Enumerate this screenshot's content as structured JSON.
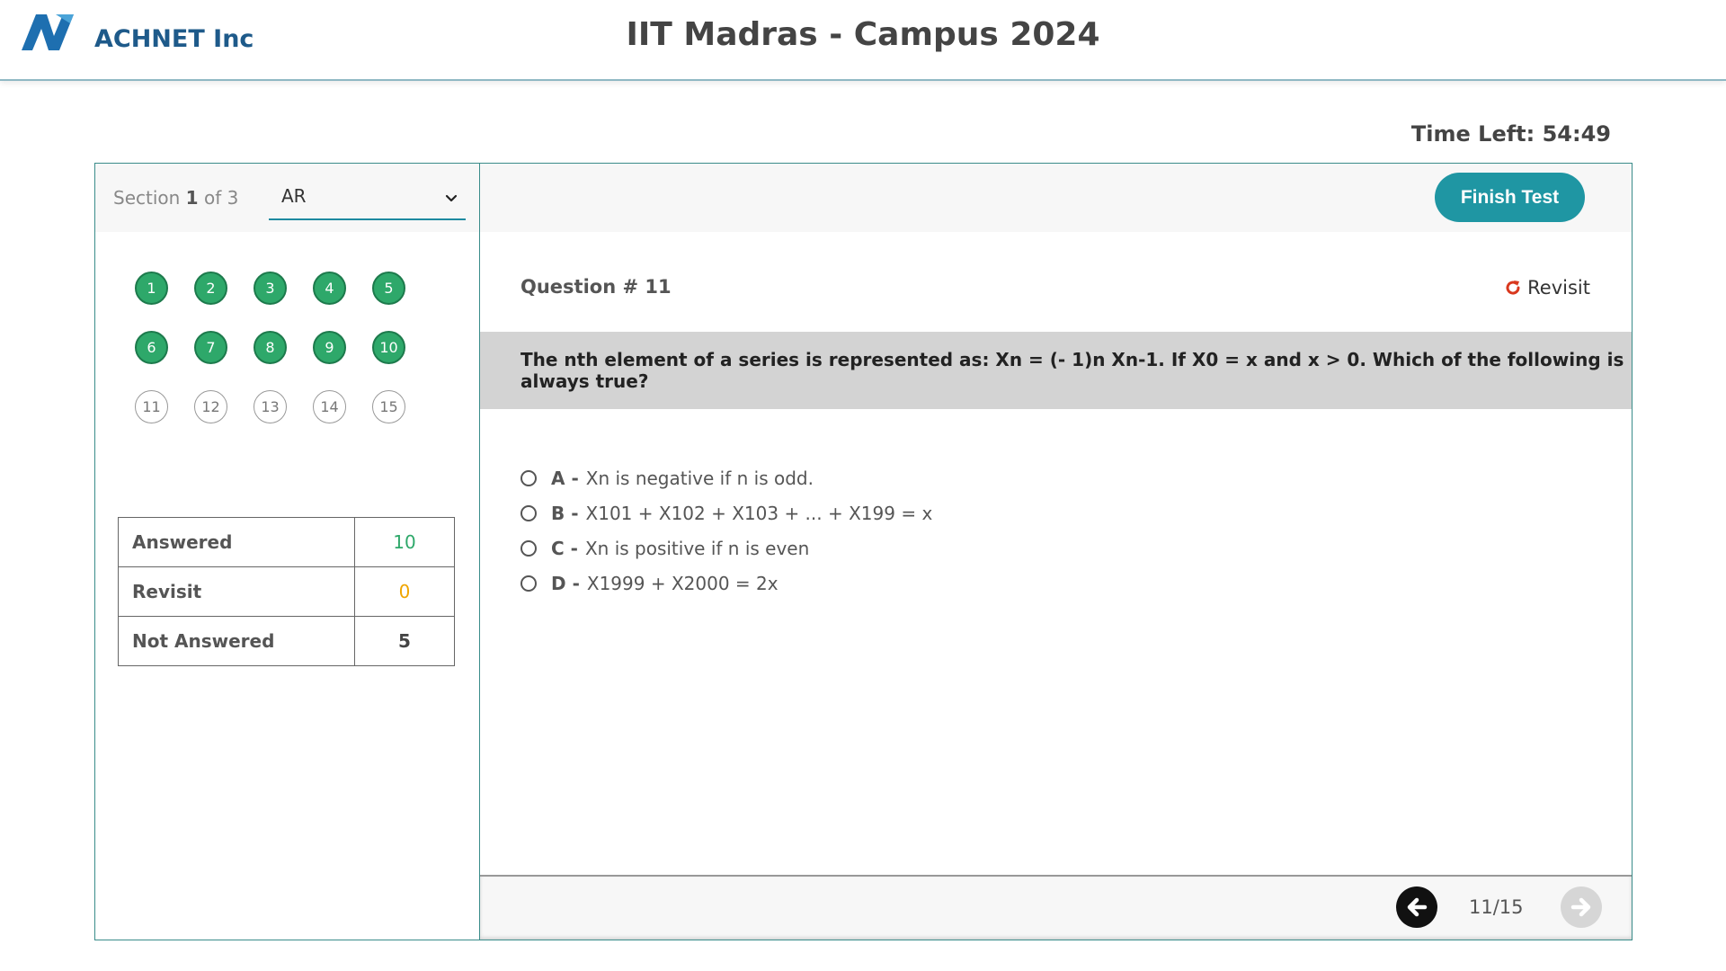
{
  "header": {
    "brand": "ACHNET Inc",
    "title": "IIT Madras - Campus 2024"
  },
  "timer": {
    "label": "Time Left: 54:49"
  },
  "section": {
    "prefix": "Section",
    "current": "1",
    "suffix": "of 3",
    "selected": "AR"
  },
  "questions": [
    {
      "num": "1",
      "status": "answered"
    },
    {
      "num": "2",
      "status": "answered"
    },
    {
      "num": "3",
      "status": "answered"
    },
    {
      "num": "4",
      "status": "answered"
    },
    {
      "num": "5",
      "status": "answered"
    },
    {
      "num": "6",
      "status": "answered"
    },
    {
      "num": "7",
      "status": "answered"
    },
    {
      "num": "8",
      "status": "answered"
    },
    {
      "num": "9",
      "status": "answered"
    },
    {
      "num": "10",
      "status": "answered"
    },
    {
      "num": "11",
      "status": "not-answered"
    },
    {
      "num": "12",
      "status": "not-answered"
    },
    {
      "num": "13",
      "status": "not-answered"
    },
    {
      "num": "14",
      "status": "not-answered"
    },
    {
      "num": "15",
      "status": "not-answered"
    }
  ],
  "stats": {
    "answered_label": "Answered",
    "answered_value": "10",
    "revisit_label": "Revisit",
    "revisit_value": "0",
    "not_answered_label": "Not Answered",
    "not_answered_value": "5"
  },
  "colors": {
    "answered": "#2ea86a",
    "revisit": "#f0a500",
    "accent": "#1f96a3",
    "revisit_icon": "#d9381e"
  },
  "actions": {
    "finish": "Finish Test",
    "revisit": "Revisit"
  },
  "question": {
    "number_label": "Question # 11",
    "text": "The nth element of a series is represented as: Xn = (- 1)n Xn-1. If X0 = x and x > 0. Which of the following is always true?",
    "options": [
      {
        "letter": "A -",
        "text": "Xn is negative if n is odd."
      },
      {
        "letter": "B -",
        "text": "X101 + X102 + X103 + ... + X199 = x"
      },
      {
        "letter": "C -",
        "text": "Xn is positive if n is even"
      },
      {
        "letter": "D -",
        "text": "X1999 + X2000 = 2x"
      }
    ]
  },
  "pagination": {
    "label": "11/15"
  },
  "icons": {
    "logo": "achnet-logo",
    "section_dropdown": "chevron-down-icon",
    "revisit": "refresh-icon",
    "prev": "arrow-left-icon",
    "next": "arrow-right-icon"
  }
}
